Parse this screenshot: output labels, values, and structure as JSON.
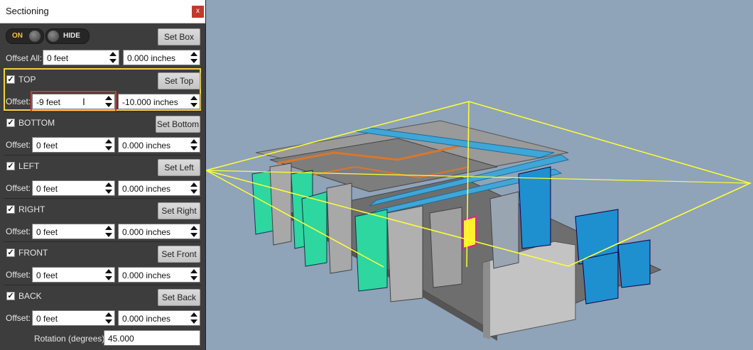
{
  "window": {
    "title": "Sectioning",
    "close_label": "x"
  },
  "toggles": {
    "on_label": "ON",
    "hide_label": "HIDE"
  },
  "set_box_label": "Set Box",
  "offset_all": {
    "label": "Offset All:",
    "feet": "0 feet",
    "inches": "0.000 inches"
  },
  "sections": [
    {
      "name": "TOP",
      "checked": true,
      "button": "Set Top",
      "offset_label": "Offset:",
      "feet": "-9 feet",
      "inches": "-10.000 inches"
    },
    {
      "name": "BOTTOM",
      "checked": true,
      "button": "Set Bottom",
      "offset_label": "Offset:",
      "feet": "0 feet",
      "inches": "0.000 inches"
    },
    {
      "name": "LEFT",
      "checked": true,
      "button": "Set Left",
      "offset_label": "Offset:",
      "feet": "0 feet",
      "inches": "0.000 inches"
    },
    {
      "name": "RIGHT",
      "checked": true,
      "button": "Set Right",
      "offset_label": "Offset:",
      "feet": "0 feet",
      "inches": "0.000 inches"
    },
    {
      "name": "FRONT",
      "checked": true,
      "button": "Set Front",
      "offset_label": "Offset:",
      "feet": "0 feet",
      "inches": "0.000 inches"
    },
    {
      "name": "BACK",
      "checked": true,
      "button": "Set Back",
      "offset_label": "Offset:",
      "feet": "0 feet",
      "inches": "0.000 inches"
    }
  ],
  "rotation": {
    "label": "Rotation (degrees):",
    "value": "45.000"
  },
  "colors": {
    "panel": "#3d3d3d",
    "highlight": "#f2d23c",
    "focus": "#e0302c",
    "section_box": "#ffff33",
    "viewport": "#8fa3b9"
  }
}
